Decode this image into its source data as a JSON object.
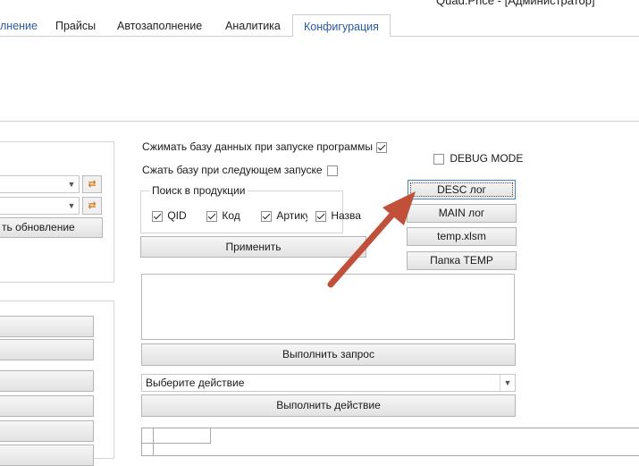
{
  "window": {
    "title": "Quad.Price - [Администратор]"
  },
  "tabs": [
    {
      "label": "лнение"
    },
    {
      "label": "Прайсы"
    },
    {
      "label": "Автозаполнение"
    },
    {
      "label": "Аналитика"
    },
    {
      "label": "Конфигурация",
      "active": true
    }
  ],
  "left": {
    "update_button": "ть обновление",
    "icon_button": "refresh-icon"
  },
  "options": {
    "compress_on_start": {
      "label": "Сжимать базу данных при запуске программы",
      "checked": true
    },
    "compress_next_start": {
      "label": "Сжать базу при следующем запуске",
      "checked": false
    },
    "search_group": {
      "title": "Поиск в продукции",
      "items": [
        {
          "label": "QID",
          "checked": true
        },
        {
          "label": "Код",
          "checked": true
        },
        {
          "label": "Артику",
          "checked": true
        },
        {
          "label": "Назва",
          "checked": true
        }
      ]
    },
    "apply_button": "Применить"
  },
  "debug": {
    "debug_mode": {
      "label": "DEBUG MODE",
      "checked": false
    },
    "desc_log": "DESC лог",
    "main_log": "MAIN лог",
    "temp_xlsm": "temp.xlsm",
    "temp_folder": "Папка TEMP"
  },
  "query": {
    "text": "",
    "run_button": "Выполнить запрос"
  },
  "action": {
    "select_value": "Выберите действие",
    "run_button": "Выполнить действие"
  },
  "colors": {
    "accent": "#2a5a9e",
    "arrow": "#c0503a"
  }
}
